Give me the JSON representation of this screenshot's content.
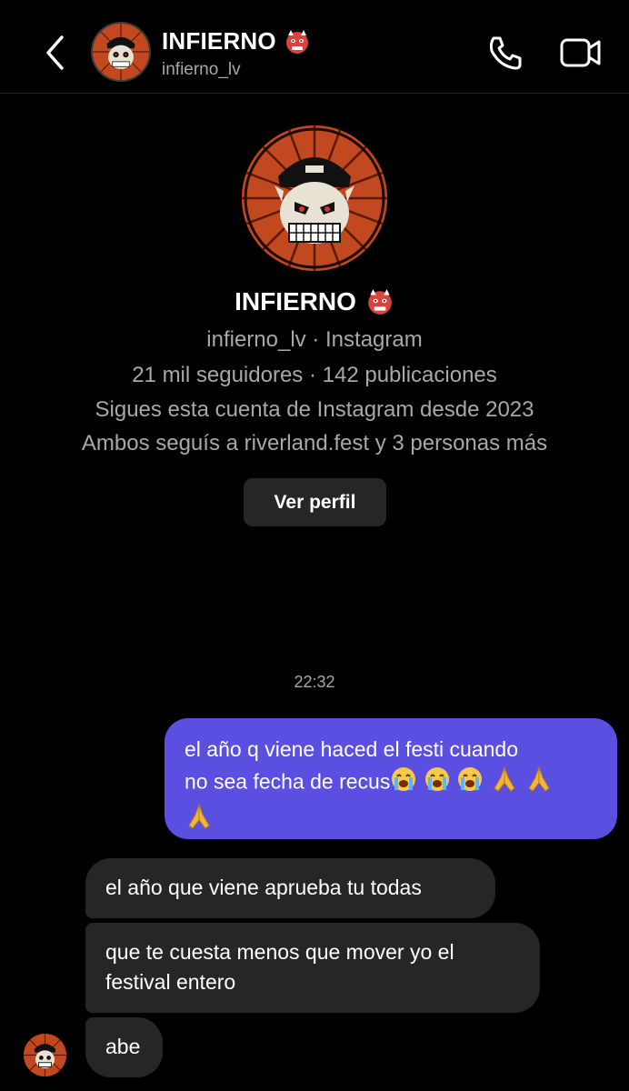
{
  "header": {
    "title": "INFIERNO",
    "username": "infierno_lv",
    "back_icon": "chevron-left-icon",
    "call_icon": "phone-icon",
    "video_icon": "video-camera-icon"
  },
  "profile": {
    "name": "INFIERNO",
    "name_emoji": "ogre-emoji",
    "handle_line": "infierno_lv · Instagram",
    "stats_line": "21 mil seguidores · 142 publicaciones",
    "following_since": "Sigues esta cuenta de Instagram desde 2023",
    "mutuals": "Ambos seguís a riverland.fest y 3 personas más",
    "view_profile_label": "Ver perfil"
  },
  "conversation": {
    "timestamp": "22:32",
    "outgoing": {
      "line1": "el año q viene haced el festi cuando",
      "line2": "no sea fecha de recus",
      "emojis": [
        "loudly-crying-face",
        "loudly-crying-face",
        "loudly-crying-face",
        "folded-hands",
        "folded-hands",
        "folded-hands"
      ]
    },
    "incoming": [
      "el año que viene aprueba tu todas",
      "que te cuesta menos que mover yo el festival entero",
      "abe"
    ]
  },
  "colors": {
    "background": "#000000",
    "outgoing_bubble": "#5a4fe0",
    "incoming_bubble": "#262626",
    "secondary_text": "#a8a8a8",
    "avatar_orange": "#b8421c"
  }
}
